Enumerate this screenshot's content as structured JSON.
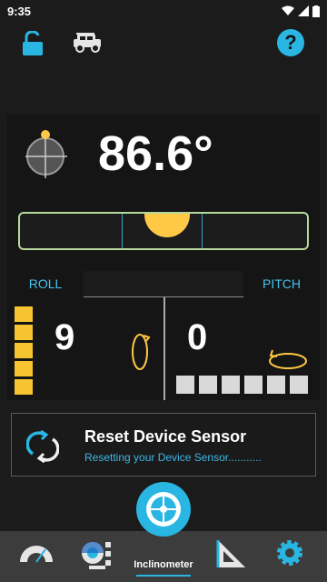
{
  "status": {
    "time": "9:35"
  },
  "angle": {
    "value": "86.6°"
  },
  "tabs": {
    "roll_label": "ROLL",
    "pitch_label": "PITCH"
  },
  "roll": {
    "value": "9",
    "active_blocks": 5
  },
  "pitch": {
    "value": "0",
    "blocks": 6
  },
  "reset": {
    "title": "Reset Device Sensor",
    "subtitle": "Resetting your Device Sensor..........."
  },
  "nav": {
    "active_label": "Inclinometer"
  },
  "colors": {
    "accent": "#29b6e2",
    "bubble": "#ffc845",
    "roll_bar": "#f6c431",
    "level_border": "#b6d89b"
  }
}
